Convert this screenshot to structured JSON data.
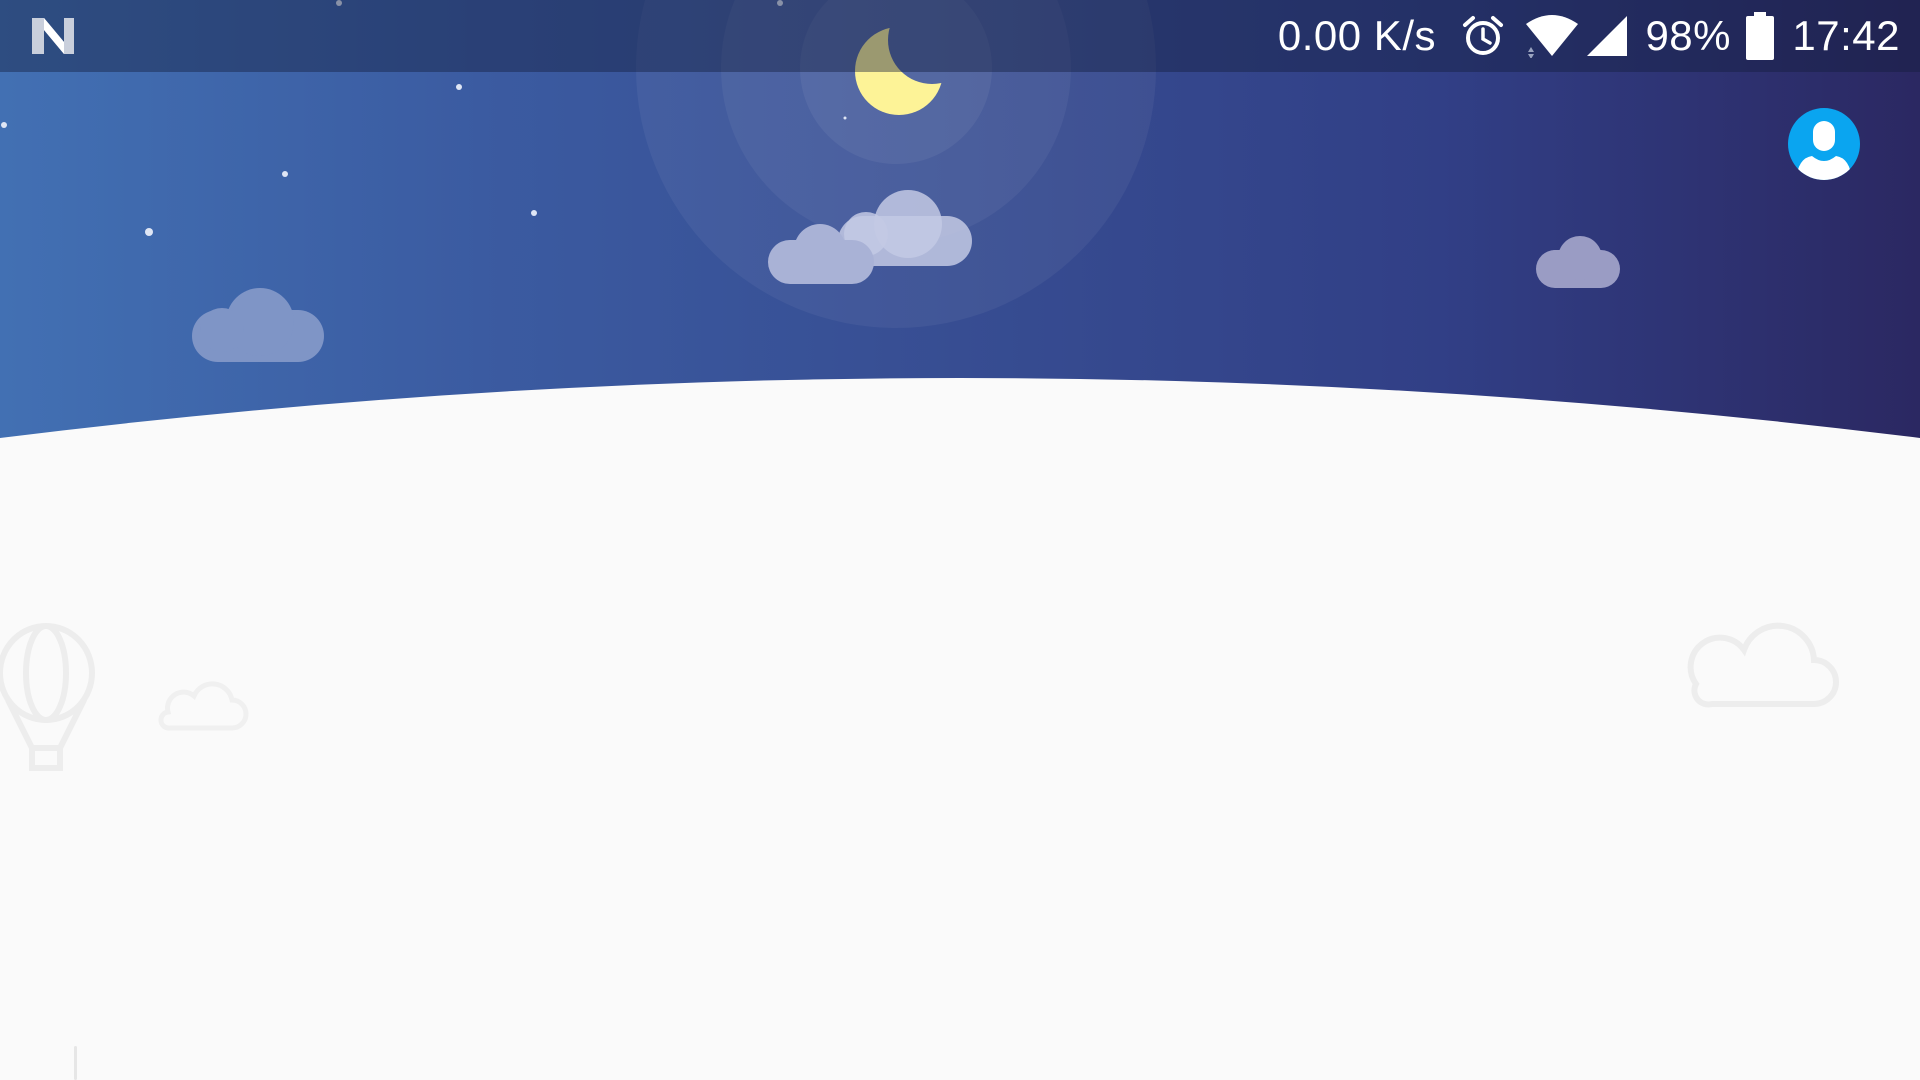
{
  "status_bar": {
    "notification_icon": "android-n-icon",
    "network_speed": "0.00 K/s",
    "alarm_icon": "alarm-clock-icon",
    "wifi_icon": "wifi-icon",
    "signal_icon": "cell-signal-icon",
    "battery_percent": "98%",
    "battery_level": 0.98,
    "battery_icon": "battery-icon",
    "time": "17:42"
  },
  "header": {
    "scene": "night-sky",
    "moon_icon": "crescent-moon-icon",
    "profile_icon": "user-avatar-icon"
  },
  "colors": {
    "sky_left": "#4270b3",
    "sky_right": "#2b2862",
    "moon": "#fdf397",
    "cloud": "#c3c9e4",
    "profile_accent": "#0aa5f0",
    "background": "#fafafa",
    "decoration_stroke": "#ededed"
  },
  "decorations": {
    "balloon_icon": "hot-air-balloon-icon",
    "cloud_outline_icon": "cloud-outline-icon"
  }
}
